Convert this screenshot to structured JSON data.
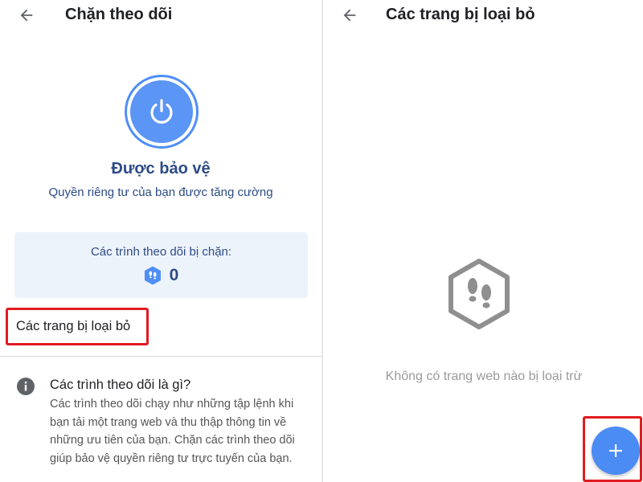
{
  "left_screen": {
    "title": "Chặn theo dõi",
    "status_title": "Được bảo vệ",
    "status_subtitle": "Quyền riêng tư của bạn được tăng cường",
    "blocked_label": "Các trình theo dõi bị chặn:",
    "blocked_count": "0",
    "excluded_sites_item": "Các trang bị loại bỏ",
    "info_title": "Các trình theo dõi là gì?",
    "info_description": "Các trình theo dõi chạy như những tập lệnh khi bạn tải một trang web và thu thập thông tin về những ưu tiên của bạn. Chặn các trình theo dõi giúp bảo vệ quyền riêng tư trực tuyến của bạn."
  },
  "right_screen": {
    "title": "Các trang bị loại bỏ",
    "empty_message": "Không có trang web nào bị loại trừ"
  },
  "icons": {
    "back": "arrow-back-icon",
    "power": "power-icon",
    "tracker_badge": "footprints-hexagon-icon",
    "info": "info-icon",
    "empty_state": "footprints-hexagon-icon",
    "add": "plus-icon"
  },
  "colors": {
    "accent_blue": "#4e8ef7",
    "text_dark_blue": "#2d4b86",
    "card_background": "#edf3fb",
    "highlight_red": "#e11b22",
    "muted_gray": "#9a9a9a"
  }
}
